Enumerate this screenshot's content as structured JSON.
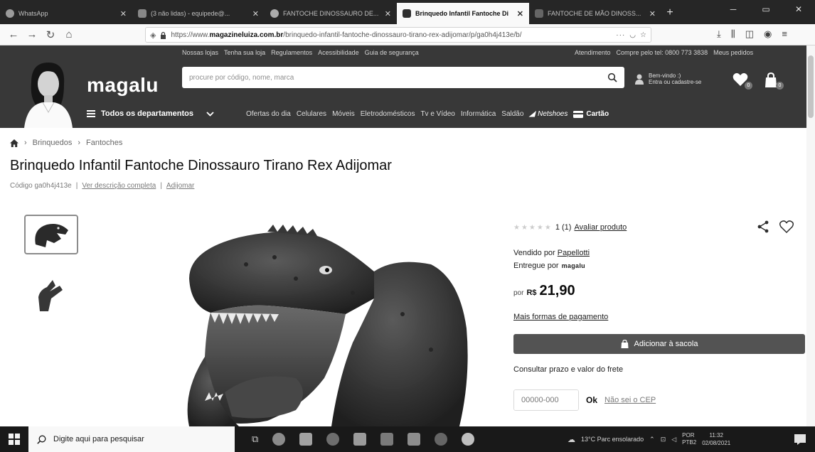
{
  "browser": {
    "tabs": [
      {
        "title": "WhatsApp",
        "active": false
      },
      {
        "title": "(3 não lidas) - equipede@...",
        "active": false
      },
      {
        "title": "FANTOCHE DINOSSAURO DE...",
        "active": false
      },
      {
        "title": "Brinquedo Infantil Fantoche Di",
        "active": true
      },
      {
        "title": "FANTOCHE DE MÃO DINOSS...",
        "active": false
      }
    ],
    "url_prefix": "https://www.",
    "url_domain": "magazineluiza.com.br",
    "url_path": "/brinquedo-infantil-fantoche-dinossauro-tirano-rex-adijomar/p/ga0h4j413e/b/"
  },
  "header": {
    "logo": "magalu",
    "top_links": [
      "Nossas lojas",
      "Tenha sua loja",
      "Regulamentos",
      "Acessibilidade",
      "Guia de segurança"
    ],
    "top_right_links": [
      "Atendimento",
      "Compre pelo tel: 0800 773 3838",
      "Meus pedidos"
    ],
    "search_placeholder": "procure por código, nome, marca",
    "login_line1": "Bem-vindo :)",
    "login_line2": "Entra ou cadastre-se",
    "favorites_count": "0",
    "bag_count": "0",
    "departments_label": "Todos os departamentos",
    "nav_links": [
      "Ofertas do dia",
      "Celulares",
      "Móveis",
      "Eletrodomésticos",
      "Tv e Vídeo",
      "Informática",
      "Saldão"
    ],
    "netshoes_label": "Netshoes",
    "cartao_label": "Cartão"
  },
  "breadcrumb": [
    "Brinquedos",
    "Fantoches"
  ],
  "product": {
    "title": "Brinquedo Infantil Fantoche Dinossauro Tirano Rex Adijomar",
    "code_label": "Código ga0h4j413e",
    "description_link": "Ver descrição completa",
    "brand_link": "Adijomar",
    "rating_text": "1 (1)",
    "rating_stars": 1,
    "rating_link": "Avaliar produto",
    "seller_prefix": "Vendido por",
    "seller_name": "Papellotti",
    "delivery_prefix": "Entregue por",
    "delivery_brand": "magalu",
    "price_prefix": "por",
    "price_currency": "R$",
    "price_value": "21,90",
    "payment_link": "Mais formas de pagamento",
    "add_button": "Adicionar à sacola",
    "freight_label": "Consultar prazo e valor do frete",
    "cep_placeholder": "00000-000",
    "cep_ok": "Ok",
    "cep_help": "Não sei o CEP"
  },
  "taskbar": {
    "search_placeholder": "Digite aqui para pesquisar",
    "weather": "13°C Parc ensolarado",
    "lang1": "POR",
    "lang2": "PTB2",
    "time": "11:32",
    "date": "02/08/2021"
  }
}
